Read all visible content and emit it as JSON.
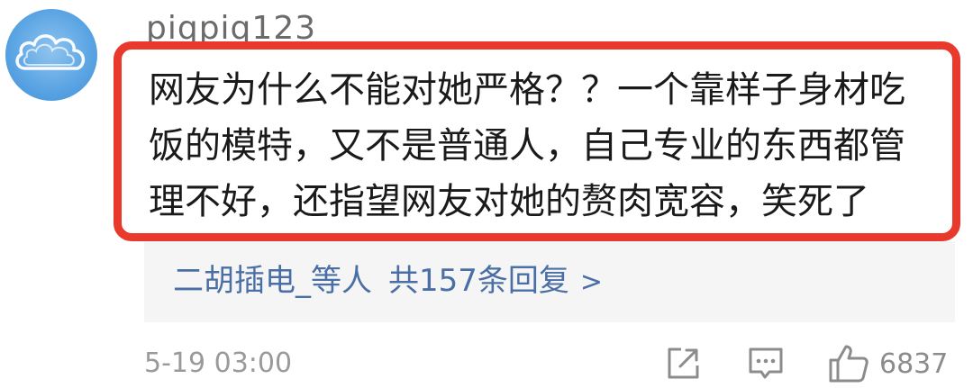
{
  "comment": {
    "username": "piqpiq123",
    "text": "网友为什么不能对她严格？？一个靠样子身材吃饭的模特，又不是普通人，自己专业的东西都管理不好，还指望网友对她的赘肉宽容，笑死了",
    "replies": {
      "names": "二胡插电_等人",
      "count_text": "共157条回复",
      "chevron": ">"
    },
    "timestamp": "5-19 03:00",
    "likes": "6837",
    "icons": {
      "avatar": "cloud-avatar",
      "share": "share-icon",
      "comment": "comment-icon",
      "like": "thumbs-up-icon"
    },
    "colors": {
      "highlight_border": "#e8392c",
      "link": "#4a6fa5",
      "reply_bg": "#f5f5f5"
    }
  }
}
